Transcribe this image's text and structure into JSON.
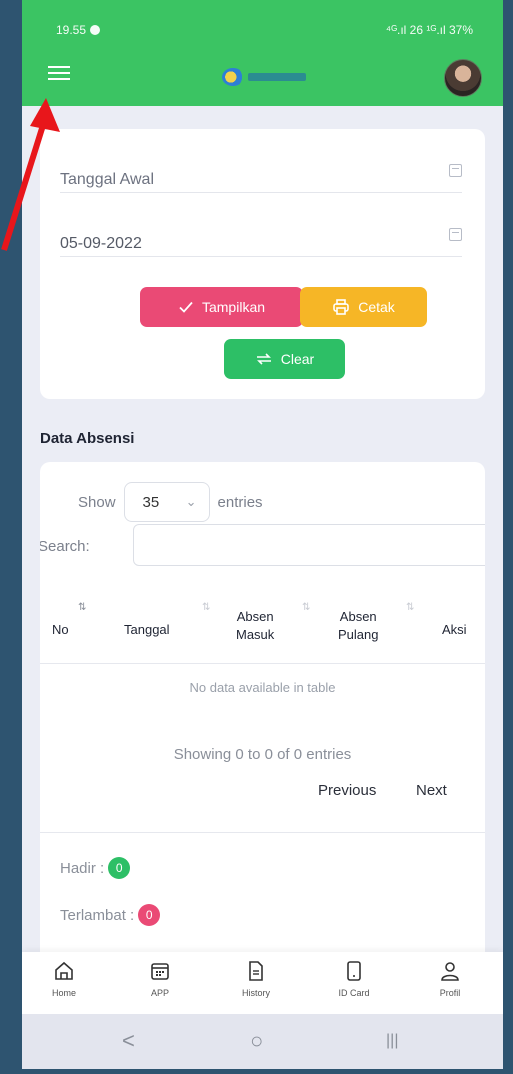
{
  "status_bar": {
    "time": "19.55",
    "right": "⁴ᴳ.ıl 26 ¹ᴳ.ıl 37%"
  },
  "header": {
    "logo_text": ""
  },
  "filter": {
    "start_date_placeholder": "Tanggal Awal",
    "end_date_value": "05-09-2022",
    "show_label": "Tampilkan",
    "print_label": "Cetak",
    "clear_label": "Clear"
  },
  "section": {
    "title": "Data Absensi"
  },
  "table": {
    "show_label": "Show",
    "page_size": "35",
    "entries_label": "entries",
    "search_label": "Search:",
    "columns": {
      "no": "No",
      "tanggal": "Tanggal",
      "absen_masuk_1": "Absen",
      "absen_masuk_2": "Masuk",
      "absen_pulang_1": "Absen",
      "absen_pulang_2": "Pulang",
      "aksi": "Aksi"
    },
    "empty_message": "No data available in table",
    "info": "Showing 0 to 0 of 0 entries",
    "prev": "Previous",
    "next": "Next"
  },
  "summary": {
    "hadir_label": "Hadir :",
    "hadir_count": "0",
    "terlambat_label": "Terlambat :",
    "terlambat_count": "0"
  },
  "bottom_nav": {
    "home": "Home",
    "app": "APP",
    "history": "History",
    "idcard": "ID Card",
    "profil": "Profil"
  },
  "system_nav": {
    "back": "<",
    "home": "○",
    "recents": "|||"
  },
  "colors": {
    "primary_green": "#3bc463",
    "pink": "#ea4a75",
    "orange": "#f6b626",
    "annotation_red": "#e8161b"
  }
}
